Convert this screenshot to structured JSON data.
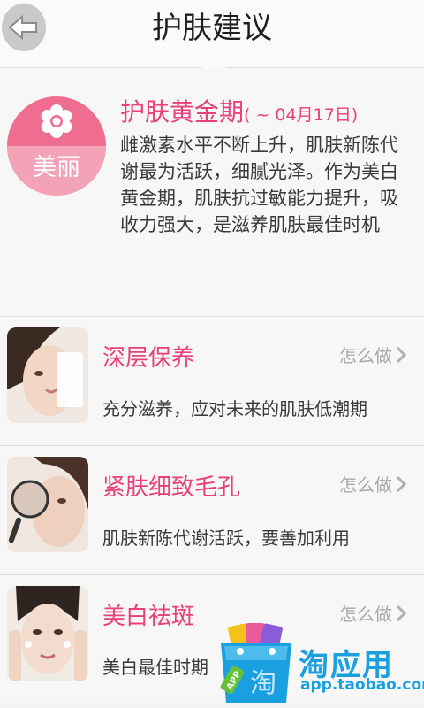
{
  "header": {
    "title": "护肤建议",
    "back_icon": "arrow-left-icon"
  },
  "intro": {
    "badge_label": "美丽",
    "badge_icon": "flower-icon",
    "title": "护肤黄金期",
    "date_range": "( ~ 04月17日)",
    "description": "雌激素水平不断上升，肌肤新陈代谢最为活跃，细腻光泽。作为美白黄金期，肌肤抗过敏能力提升，吸收力强大，是滋养肌肤最佳时机"
  },
  "items": [
    {
      "title": "深层保养",
      "action": "怎么做",
      "desc": "充分滋养，应对未来的肌肤低潮期"
    },
    {
      "title": "紧肤细致毛孔",
      "action": "怎么做",
      "desc": "肌肤新陈代谢活跃，要善加利用"
    },
    {
      "title": "美白祛斑",
      "action": "怎么做",
      "desc": "美白最佳时期"
    }
  ],
  "store_badge": {
    "name": "淘应用",
    "url": "app.taobao.com",
    "bag_label": "淘",
    "tag": "APP"
  },
  "colors": {
    "accent": "#e8407a",
    "badge_top": "#f06d92",
    "badge_bottom": "#f3a2b8",
    "store": "#1aa0e0"
  }
}
